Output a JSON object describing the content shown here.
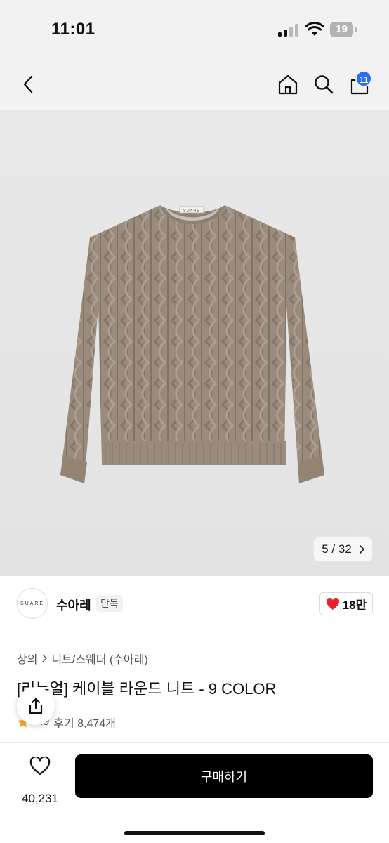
{
  "status": {
    "time": "11:01",
    "battery": "19"
  },
  "nav": {
    "cart_count": "11"
  },
  "gallery": {
    "current": "5",
    "separator": "/",
    "total": "32",
    "label_brand": "SUARE"
  },
  "brand": {
    "logo_text": "SUARE",
    "name": "수아레",
    "tag": "단독",
    "likes": "18만"
  },
  "breadcrumb": [
    "상의",
    "니트/스웨터 (수아레)"
  ],
  "product": {
    "title": "[리뉴얼] 케이블 라운드 니트 - 9 COLOR"
  },
  "rating": {
    "score": "4.9",
    "reviews_label": "후기 8,474개"
  },
  "bottom": {
    "wish_count": "40,231",
    "buy_label": "구매하기"
  },
  "colors": {
    "accent_badge": "#2b6cf0",
    "heart": "#e8222b",
    "button": "#000000"
  }
}
